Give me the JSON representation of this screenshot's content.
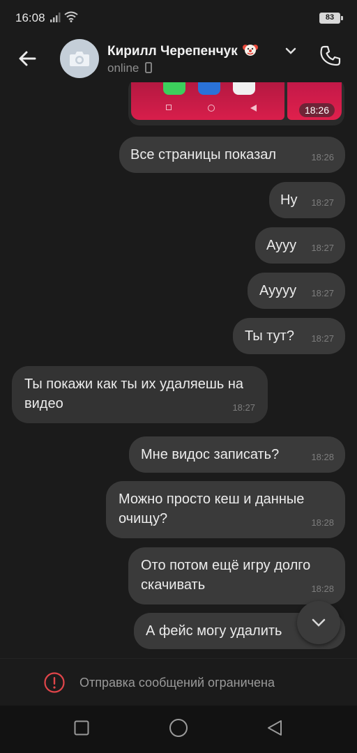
{
  "status_bar": {
    "time": "16:08",
    "battery": "83"
  },
  "header": {
    "contact_name": "Кирилл Черепенчук",
    "contact_emoji": "clown-face-icon",
    "status": "online",
    "icons": [
      "back-arrow-icon",
      "camera-icon",
      "chevron-down-icon",
      "mobile-icon",
      "phone-icon"
    ]
  },
  "chat": {
    "photo_time": "18:26",
    "messages": [
      {
        "direction": "out",
        "text": "Все страницы показал",
        "time": "18:26"
      },
      {
        "direction": "out",
        "text": "Ну",
        "time": "18:27"
      },
      {
        "direction": "out",
        "text": "Аууу",
        "time": "18:27"
      },
      {
        "direction": "out",
        "text": "Ауууу",
        "time": "18:27"
      },
      {
        "direction": "out",
        "text": "Ты тут?",
        "time": "18:27"
      },
      {
        "direction": "in",
        "text": "Ты покажи как ты их удаляешь на видео",
        "time": "18:27"
      },
      {
        "direction": "out",
        "text": "Мне видос записать?",
        "time": "18:28"
      },
      {
        "direction": "out",
        "text": "Можно просто кеш и данные очищу?",
        "time": "18:28"
      },
      {
        "direction": "out",
        "text": "Ото потом ещё игру долго скачивать",
        "time": "18:28"
      },
      {
        "direction": "out",
        "text": "А фейс могу удалить",
        "time": ""
      }
    ]
  },
  "restricted": {
    "text": "Отправка сообщений ограничена"
  },
  "colors": {
    "background": "#1b1b1b",
    "bubble": "#3a3a3a",
    "warning": "#e0454a"
  }
}
